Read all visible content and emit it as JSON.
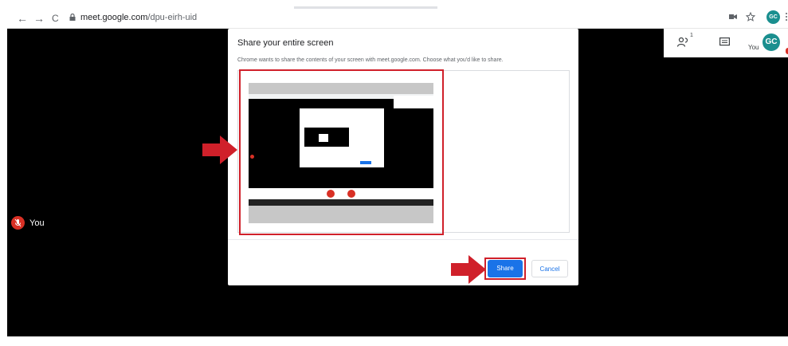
{
  "browser": {
    "back_label": "←",
    "forward_label": "→",
    "reload_label": "C",
    "url_host": "meet.google.com",
    "url_path": "/dpu-eirh-uid",
    "avatar_initials": "GC"
  },
  "meet": {
    "self_name": "You",
    "participant_count": "1",
    "you_label": "You",
    "avatar_initials": "GC"
  },
  "dialog": {
    "title": "Share your entire screen",
    "description": "Chrome wants to share the contents of your screen with meet.google.com. Choose what you'd like to share.",
    "share_label": "Share",
    "cancel_label": "Cancel"
  },
  "colors": {
    "accent": "#1a73e8",
    "highlight": "#d0202a",
    "mic_off": "#d93025",
    "avatar": "#1a8f8f"
  },
  "icons": [
    "back-icon",
    "forward-icon",
    "reload-icon",
    "lock-icon",
    "camera-icon",
    "star-icon",
    "menu-icon",
    "people-icon",
    "chat-icon",
    "mic-off-icon",
    "arrow-icon"
  ]
}
